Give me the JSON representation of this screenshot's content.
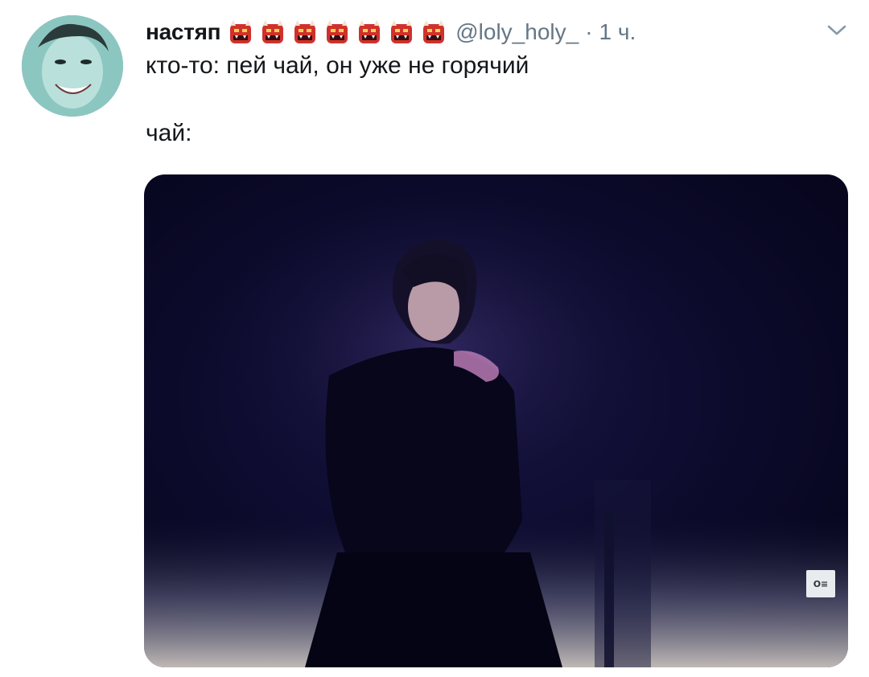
{
  "tweet": {
    "author": {
      "display_name": "настяп",
      "emoji_count": 7,
      "emoji_icon": "ogre-icon",
      "handle": "@loly_holy_",
      "separator": "·",
      "time": "1 ч."
    },
    "text_line1": "кто-то: пей чай, он уже не горячий",
    "text_line2": "чай:",
    "menu_icon": "chevron-down-icon",
    "media": {
      "type": "video-gif",
      "watermark_badge": "O≡"
    }
  },
  "colors": {
    "text_primary": "#14171a",
    "text_secondary": "#657786",
    "emoji_red": "#d0312d",
    "media_background": "#0b0a2a"
  }
}
